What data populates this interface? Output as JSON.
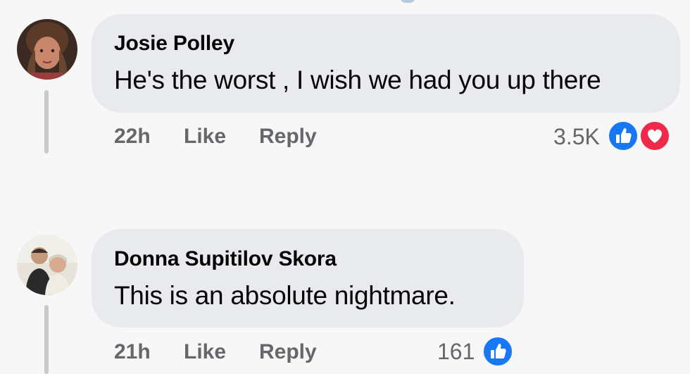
{
  "comments": [
    {
      "author": "Josie Polley",
      "text": "He's the worst , I wish we had you up there",
      "time": "22h",
      "like_label": "Like",
      "reply_label": "Reply",
      "reaction_count": "3.5K",
      "reactions": [
        "like",
        "love"
      ]
    },
    {
      "author": "Donna Supitilov Skora",
      "text": "This is an absolute nightmare.",
      "time": "21h",
      "like_label": "Like",
      "reply_label": "Reply",
      "reaction_count": "161",
      "reactions": [
        "like"
      ]
    }
  ],
  "colors": {
    "like_blue": "#1877f2",
    "love_red": "#f0284a",
    "bubble_bg": "#e9eaee",
    "meta_gray": "#65676b"
  }
}
